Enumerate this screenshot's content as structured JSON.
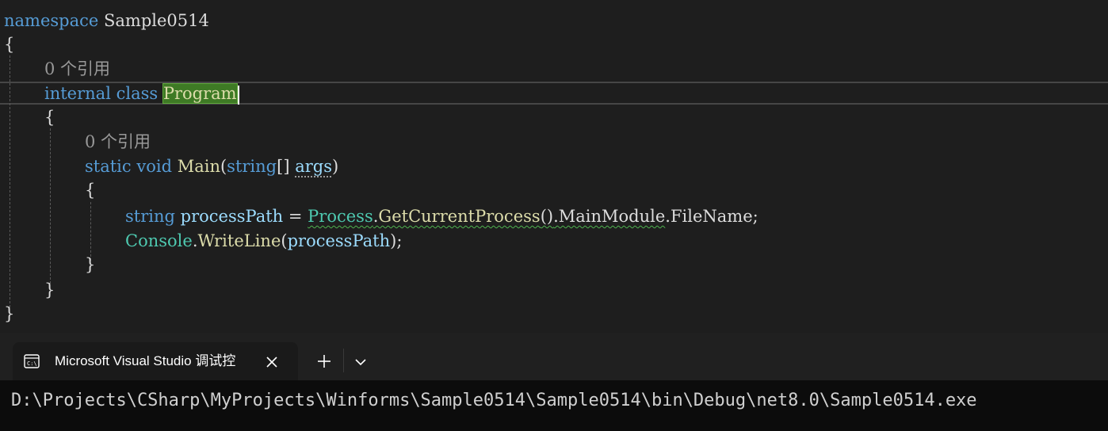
{
  "editor": {
    "lines": {
      "ns_keyword": "namespace",
      "ns_name": "Sample0514",
      "open_brace_1": "{",
      "codelens_1": "0 个引用",
      "internal_kw": "internal",
      "class_kw": "class",
      "class_name": "Program",
      "open_brace_2": "{",
      "codelens_2": "0 个引用",
      "static_kw": "static",
      "void_kw": "void",
      "main_name": "Main",
      "paren_open": "(",
      "string_kw_1": "string",
      "brackets": "[]",
      "args_name": "args",
      "paren_close": ")",
      "open_brace_3": "{",
      "string_kw_2": "string",
      "process_path_var": "processPath",
      "equals": "=",
      "process_type": "Process",
      "dot_1": ".",
      "get_current_process": "GetCurrentProcess",
      "call_parens": "()",
      "dot_2": ".",
      "main_module": "MainModule",
      "dot_3": ".",
      "file_name": "FileName",
      "semicolon_1": ";",
      "console_type": "Console",
      "dot_4": ".",
      "write_line": "WriteLine",
      "paren_open_2": "(",
      "process_path_arg": "processPath",
      "paren_close_2": ")",
      "semicolon_2": ";",
      "close_brace_3": "}",
      "close_brace_2": "}",
      "close_brace_1": "}"
    }
  },
  "terminal": {
    "tab_title": "Microsoft Visual Studio 调试控",
    "tab_icon": "console-icon",
    "close_icon": "close-icon",
    "new_tab_icon": "plus-icon",
    "dropdown_icon": "chevron-down-icon",
    "output": "D:\\Projects\\CSharp\\MyProjects\\Winforms\\Sample0514\\Sample0514\\bin\\Debug\\net8.0\\Sample0514.exe"
  },
  "colors": {
    "editor_bg": "#1e1e1e",
    "keyword": "#569cd6",
    "type": "#4ec9b0",
    "method": "#dcdcaa",
    "parameter": "#9cdcfe",
    "highlight": "#3e7a25",
    "terminal_bg": "#0c0c0c"
  }
}
